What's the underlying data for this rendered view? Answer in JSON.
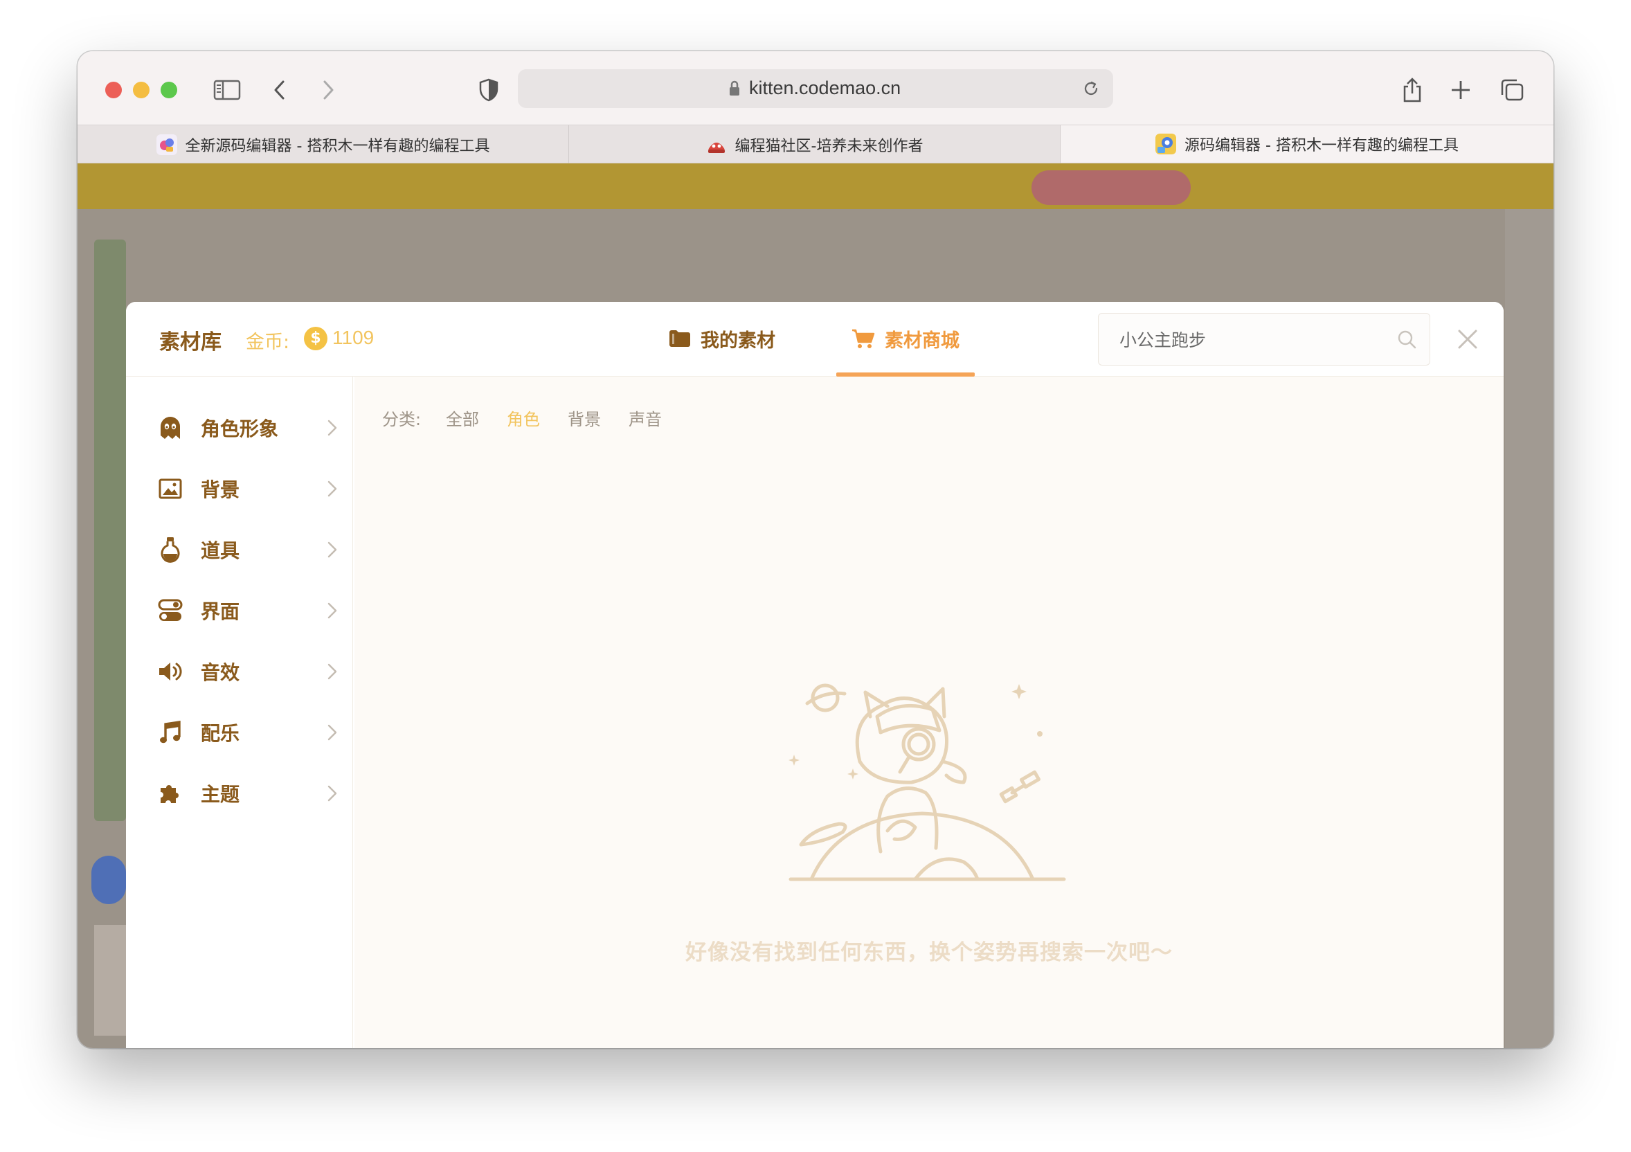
{
  "browser": {
    "url": "kitten.codemao.cn",
    "tabs": [
      {
        "title": "全新源码编辑器 - 搭积木一样有趣的编程工具",
        "active": false
      },
      {
        "title": "编程猫社区-培养未来创作者",
        "active": false
      },
      {
        "title": "源码编辑器 - 搭积木一样有趣的编程工具",
        "active": true
      }
    ]
  },
  "modal": {
    "title": "素材库",
    "coin_label": "金币:",
    "coin_symbol": "$",
    "coin_value": "1109",
    "tabs": {
      "mine": "我的素材",
      "store": "素材商城"
    },
    "active_tab": "store",
    "search": {
      "value": "小公主跑步"
    },
    "sidebar": [
      {
        "label": "角色形象",
        "icon": "ghost-icon"
      },
      {
        "label": "背景",
        "icon": "image-icon"
      },
      {
        "label": "道具",
        "icon": "potion-icon"
      },
      {
        "label": "界面",
        "icon": "toggle-icon"
      },
      {
        "label": "音效",
        "icon": "speaker-icon"
      },
      {
        "label": "配乐",
        "icon": "music-note-icon"
      },
      {
        "label": "主题",
        "icon": "puzzle-icon"
      }
    ],
    "filters": {
      "label": "分类:",
      "all": "全部",
      "role": "角色",
      "background": "背景",
      "sound": "声音",
      "selected": "角色"
    },
    "empty_message": "好像没有找到任何东西，换个姿势再搜索一次吧～"
  },
  "colors": {
    "brand_brown": "#8a5a1c",
    "accent_orange": "#f09a3e",
    "coin_yellow": "#f2c45e",
    "empty_text": "#ecdcc6"
  }
}
